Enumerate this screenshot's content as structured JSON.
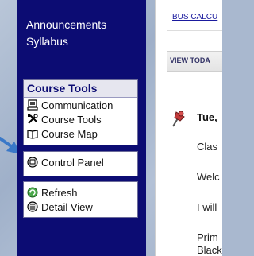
{
  "sidebar": {
    "links": [
      "Announcements",
      "Syllabus"
    ],
    "course_tools": {
      "title": "Course Tools",
      "items": [
        "Communication",
        "Course Tools",
        "Course Map"
      ]
    },
    "control_panel": {
      "label": "Control Panel"
    },
    "actions": [
      "Refresh",
      "Detail View"
    ]
  },
  "content": {
    "breadcrumb": "BUS CALCU",
    "tab": "VIEW TODA",
    "date": "Tue,",
    "lines": [
      "Clas",
      "Welc",
      "I will",
      "Prim",
      "Black"
    ]
  },
  "icons": [
    "pointer-arrow-icon",
    "computer-icon",
    "tools-icon",
    "map-book-icon",
    "control-panel-icon",
    "refresh-icon",
    "detail-view-icon",
    "pushpin-icon"
  ],
  "colors": {
    "sidebar_bg": "#0c0c73",
    "link_blue": "#1a1a9e",
    "arrow_blue": "#3a78c8"
  }
}
